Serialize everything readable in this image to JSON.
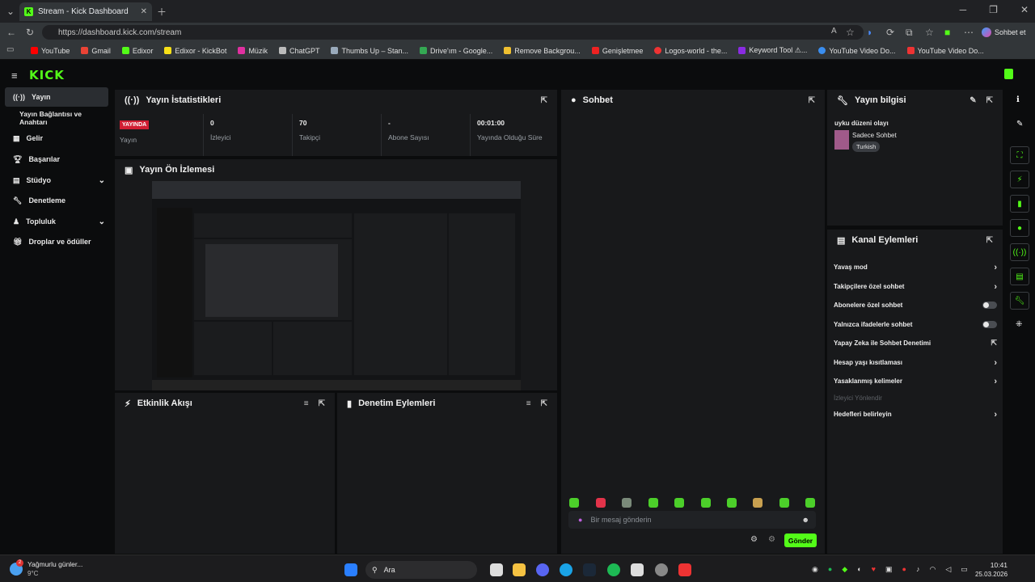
{
  "browser": {
    "tab_title": "Stream - Kick Dashboard",
    "url": "https://dashboard.kick.com/stream",
    "profile_label": "Sohbet et"
  },
  "bookmarks": [
    "YouTube",
    "Gmail",
    "Edixor",
    "Edixor - KickBot",
    "Müzik",
    "ChatGPT",
    "Thumbs Up – Stan...",
    "Drive'ım - Google...",
    "Remove Backgrou...",
    "Genişletmee",
    "Logos-world - the...",
    "Keyword Tool ⚠...",
    "YouTube Video Do...",
    "YouTube Video Do..."
  ],
  "brand": {
    "logo": "KICK"
  },
  "sidebar": {
    "items": [
      "Yayın",
      "Yayın Bağlantısı ve Anahtarı",
      "Gelir",
      "Başarılar",
      "Stüdyo",
      "Denetleme",
      "Topluluk",
      "Droplar ve ödüller"
    ]
  },
  "stats": {
    "title": "Yayın İstatistikleri",
    "live_badge": "YAYINDA",
    "live_label": "Yayın",
    "cells": [
      {
        "value": "0",
        "label": "İzleyici"
      },
      {
        "value": "70",
        "label": "Takipçi"
      },
      {
        "value": "-",
        "label": "Abone Sayısı"
      },
      {
        "value": "00:01:00",
        "label": "Yayında Olduğu Süre"
      }
    ]
  },
  "preview": {
    "title": "Yayın Ön İzlemesi"
  },
  "activity": {
    "title": "Etkinlik Akışı"
  },
  "moderation": {
    "title": "Denetim Eylemleri"
  },
  "chat": {
    "title": "Sohbet",
    "placeholder": "Bir mesaj gönderin",
    "send": "Gönder"
  },
  "stream_info": {
    "title": "Yayın bilgisi",
    "stream_title": "uyku düzeni olayı",
    "category": "Sadece Sohbet",
    "tag": "Turkish"
  },
  "channel_actions": {
    "title": "Kanal Eylemleri",
    "rows": [
      {
        "label": "Yavaş mod",
        "kind": "chevron"
      },
      {
        "label": "Takipçilere özel sohbet",
        "kind": "chevron"
      },
      {
        "label": "Abonelere özel sohbet",
        "kind": "toggle"
      },
      {
        "label": "Yalnızca ifadelerle sohbet",
        "kind": "toggle"
      },
      {
        "label": "Yapay Zeka ile Sohbet Denetimi",
        "kind": "external"
      },
      {
        "label": "Hesap yaşı kısıtlaması",
        "kind": "chevron"
      },
      {
        "label": "Yasaklanmış kelimeler",
        "kind": "chevron"
      },
      {
        "label": "İzleyici Yönlendir",
        "kind": "disabled"
      },
      {
        "label": "Hedefleri belirleyin",
        "kind": "chevron"
      }
    ]
  },
  "taskbar": {
    "weather": "Yağmurlu günler...",
    "temp": "9°C",
    "search": "Ara",
    "time": "10:41",
    "date": "25.03.2026",
    "badge": "2"
  },
  "colors": {
    "accent": "#53fc18",
    "live": "#d11e33",
    "panel": "#18191b"
  }
}
